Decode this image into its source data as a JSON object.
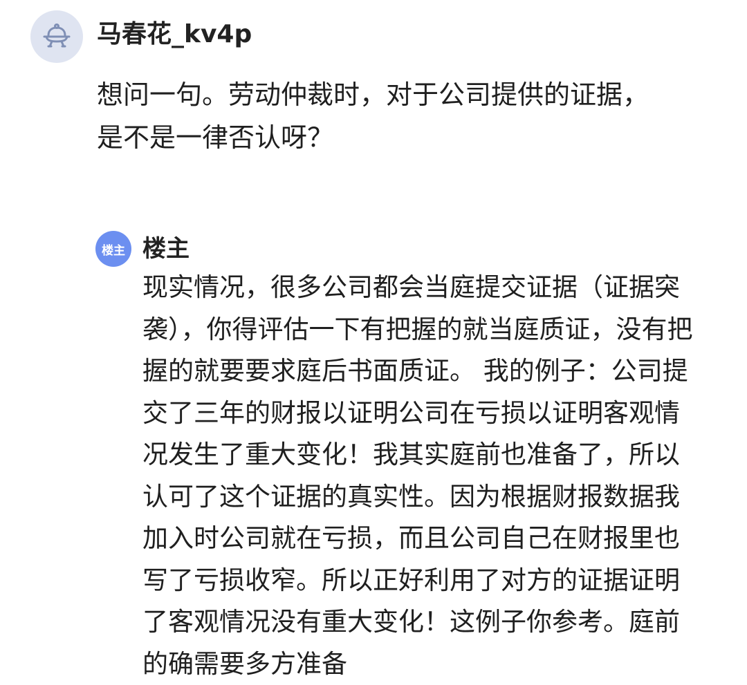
{
  "comment": {
    "avatar_icon": "ufo-robot-icon",
    "avatar_bg": "#dfe4f1",
    "username": "马春花_kv4p",
    "lines": [
      "想问一句。劳动仲裁时，对于公司提供的证据，",
      "是不是一律否认呀？"
    ]
  },
  "reply": {
    "badge": "楼主",
    "badge_color": "#6c8ff0",
    "name": "楼主",
    "lines": [
      "现实情况，很多公司都会当庭提交证据（证据突",
      "袭），你得评估一下有把握的就当庭质证，没有把",
      "握的就要要求庭后书面质证。 我的例子：公司提",
      "交了三年的财报以证明公司在亏损以证明客观情",
      "况发生了重大变化！我其实庭前也准备了，所以",
      "认可了这个证据的真实性。因为根据财报数据我",
      "加入时公司就在亏损，而且公司自己在财报里也",
      "写了亏损收窄。所以正好利用了对方的证据证明",
      "了客观情况没有重大变化！这例子你参考。庭前",
      "的确需要多方准备"
    ]
  }
}
